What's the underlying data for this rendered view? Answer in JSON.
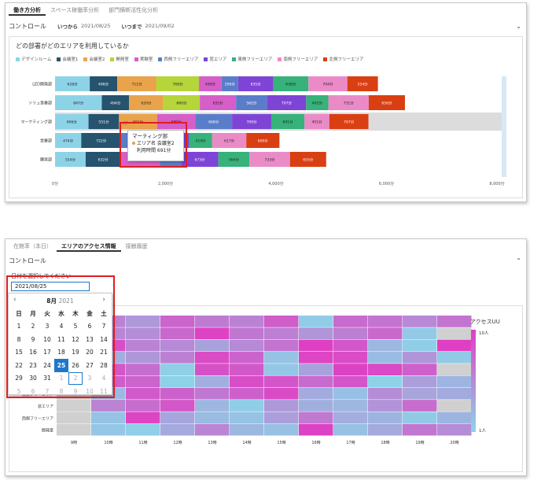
{
  "panel1": {
    "tabs": [
      {
        "label": "働き方分析",
        "active": true
      },
      {
        "label": "スペース稼働率分析",
        "active": false
      },
      {
        "label": "部門横断活性化分析",
        "active": false
      }
    ],
    "control": {
      "title": "コントロール",
      "from_label": "いつから",
      "from_value": "2021/08/25",
      "to_label": "いつまで",
      "to_value": "2021/09/02"
    },
    "chart_title": "どの部署がどのエリアを利用しているか"
  },
  "panel2": {
    "tabs": [
      {
        "label": "在館率（本日）",
        "active": false
      },
      {
        "label": "エリアのアクセス情報",
        "active": true
      },
      {
        "label": "接触履歴",
        "active": false
      }
    ],
    "control": {
      "title": "コントロール",
      "date_label": "日付を選択してください",
      "date_value": "2021/08/25"
    }
  },
  "tooltip": {
    "title": "マーティング部",
    "row1": "エリア名 会議室2",
    "row2": "利用時間 691分"
  },
  "calendar": {
    "month": "8月",
    "year": "2021",
    "weekdays": [
      "日",
      "月",
      "火",
      "水",
      "木",
      "金",
      "土"
    ],
    "days": [
      "1",
      "2",
      "3",
      "4",
      "5",
      "6",
      "7",
      "8",
      "9",
      "10",
      "11",
      "12",
      "13",
      "14",
      "15",
      "16",
      "17",
      "18",
      "19",
      "20",
      "21",
      "22",
      "23",
      "24",
      "25",
      "26",
      "27",
      "28",
      "29",
      "30",
      "31",
      "1",
      "2",
      "3",
      "4",
      "5",
      "6",
      "7",
      "8",
      "9",
      "10",
      "11"
    ],
    "selected": "25"
  },
  "colors": {
    "series": [
      "#8dd3e8",
      "#26536e",
      "#e9a44b",
      "#b5d53a",
      "#d65ec8",
      "#5a7dc9",
      "#7e44d6",
      "#37b27a",
      "#ea8bc8",
      "#d93f12"
    ],
    "heat_low": "#8dd3e8",
    "heat_high": "#e03fc3",
    "accent": "#1e78c8",
    "highlight": "#e01e1e"
  },
  "chart_data": [
    {
      "type": "bar",
      "orientation": "horizontal-stacked",
      "title": "どの部署がどのエリアを利用しているか",
      "categories": [
        "LED開発部",
        "ソリュ事業部",
        "マーケティング部",
        "営業部",
        "購買部"
      ],
      "series": [
        {
          "name": "デザインルーム",
          "values": [
            628,
            847,
            606,
            474,
            554
          ]
        },
        {
          "name": "会議室1",
          "values": [
            498,
            494,
            551,
            722,
            632
          ]
        },
        {
          "name": "会議室2",
          "values": [
            711,
            620,
            691,
            0,
            0
          ]
        },
        {
          "name": "開発室",
          "values": [
            769,
            660,
            0,
            0,
            0
          ]
        },
        {
          "name": "実験室",
          "values": [
            409,
            655,
            689,
            0,
            709
          ]
        },
        {
          "name": "西側フリーエリア",
          "values": [
            299,
            562,
            668,
            619,
            388
          ]
        },
        {
          "name": "窓エリア",
          "values": [
            635,
            707,
            709,
            611,
            673
          ]
        },
        {
          "name": "東側フリーエリア",
          "values": [
            638,
            402,
            601,
            419,
            564
          ]
        },
        {
          "name": "南側フリーエリア",
          "values": [
            704,
            731,
            451,
            617,
            733
          ]
        },
        {
          "name": "北側フリーエリア",
          "values": [
            554,
            656,
            707,
            600,
            655
          ]
        }
      ],
      "xlim": [
        0,
        8000
      ],
      "x_ticks": [
        "0分",
        "2,000分",
        "4,000分",
        "6,000分",
        "8,000分"
      ],
      "value_suffix": "分",
      "highlighted": "マーケティング部"
    },
    {
      "type": "heatmap",
      "legend_title": "アクセスUU",
      "legend_max": "10人",
      "legend_min": "1人",
      "rows": [
        "東側フリーエリア",
        "窓エリア",
        "西側フリーエリア",
        "開発室"
      ],
      "x_ticks": [
        "9時",
        "10時",
        "11時",
        "12時",
        "13時",
        "14時",
        "15時",
        "16時",
        "17時",
        "18時",
        "19時",
        "20時"
      ]
    }
  ]
}
